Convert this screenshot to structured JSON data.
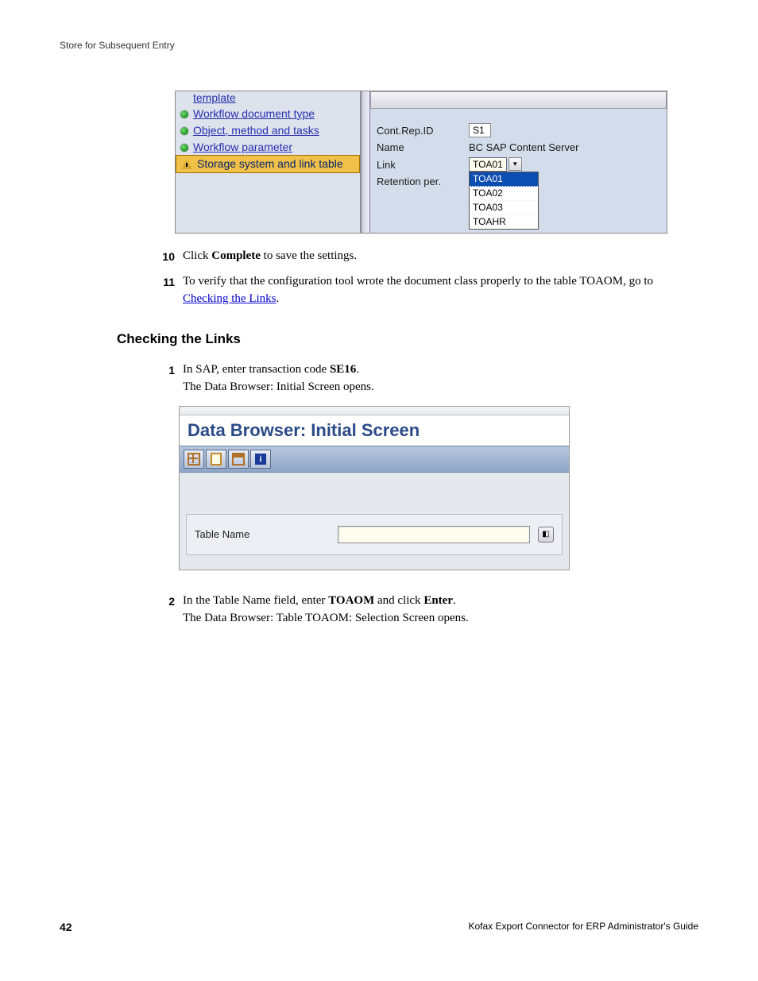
{
  "header": "Store for Subsequent Entry",
  "fig1": {
    "tree": {
      "top_cut": "template",
      "items": [
        {
          "label": "Workflow document type",
          "bullet": "dot",
          "active": false
        },
        {
          "label": "Object, method and tasks",
          "bullet": "dot",
          "active": false
        },
        {
          "label": "Workflow parameter",
          "bullet": "dot",
          "active": false
        },
        {
          "label": "Storage system and link table",
          "bullet": "tri",
          "active": true
        }
      ]
    },
    "form": {
      "cont_rep_label": "Cont.Rep.ID",
      "cont_rep_value": "S1",
      "name_label": "Name",
      "name_value": "BC SAP Content Server",
      "link_label": "Link",
      "link_value": "TOA01",
      "retention_label": "Retention per.",
      "dropdown": [
        "TOA01",
        "TOA02",
        "TOA03",
        "TOAHR"
      ]
    }
  },
  "step10": {
    "num": "10",
    "pre": "Click ",
    "bold": "Complete",
    "post": " to save the settings."
  },
  "step11": {
    "num": "11",
    "pre": "To verify that the configuration tool wrote the document class properly to the table TOAOM, go to ",
    "link": "Checking the Links",
    "post": "."
  },
  "section_heading": "Checking the Links",
  "step1": {
    "num": "1",
    "pre": "In SAP, enter transaction code ",
    "bold": "SE16",
    "post": ".",
    "line2": "The Data Browser: Initial Screen opens."
  },
  "fig2": {
    "title": "Data Browser: Initial Screen",
    "table_name_label": "Table Name"
  },
  "step2": {
    "num": "2",
    "pre": "In the Table Name field, enter ",
    "bold1": "TOAOM",
    "mid": " and click ",
    "bold2": "Enter",
    "post": ".",
    "line2": "The Data Browser: Table TOAOM: Selection Screen opens."
  },
  "footer": {
    "page": "42",
    "doc": "Kofax Export Connector for ERP Administrator's Guide"
  }
}
